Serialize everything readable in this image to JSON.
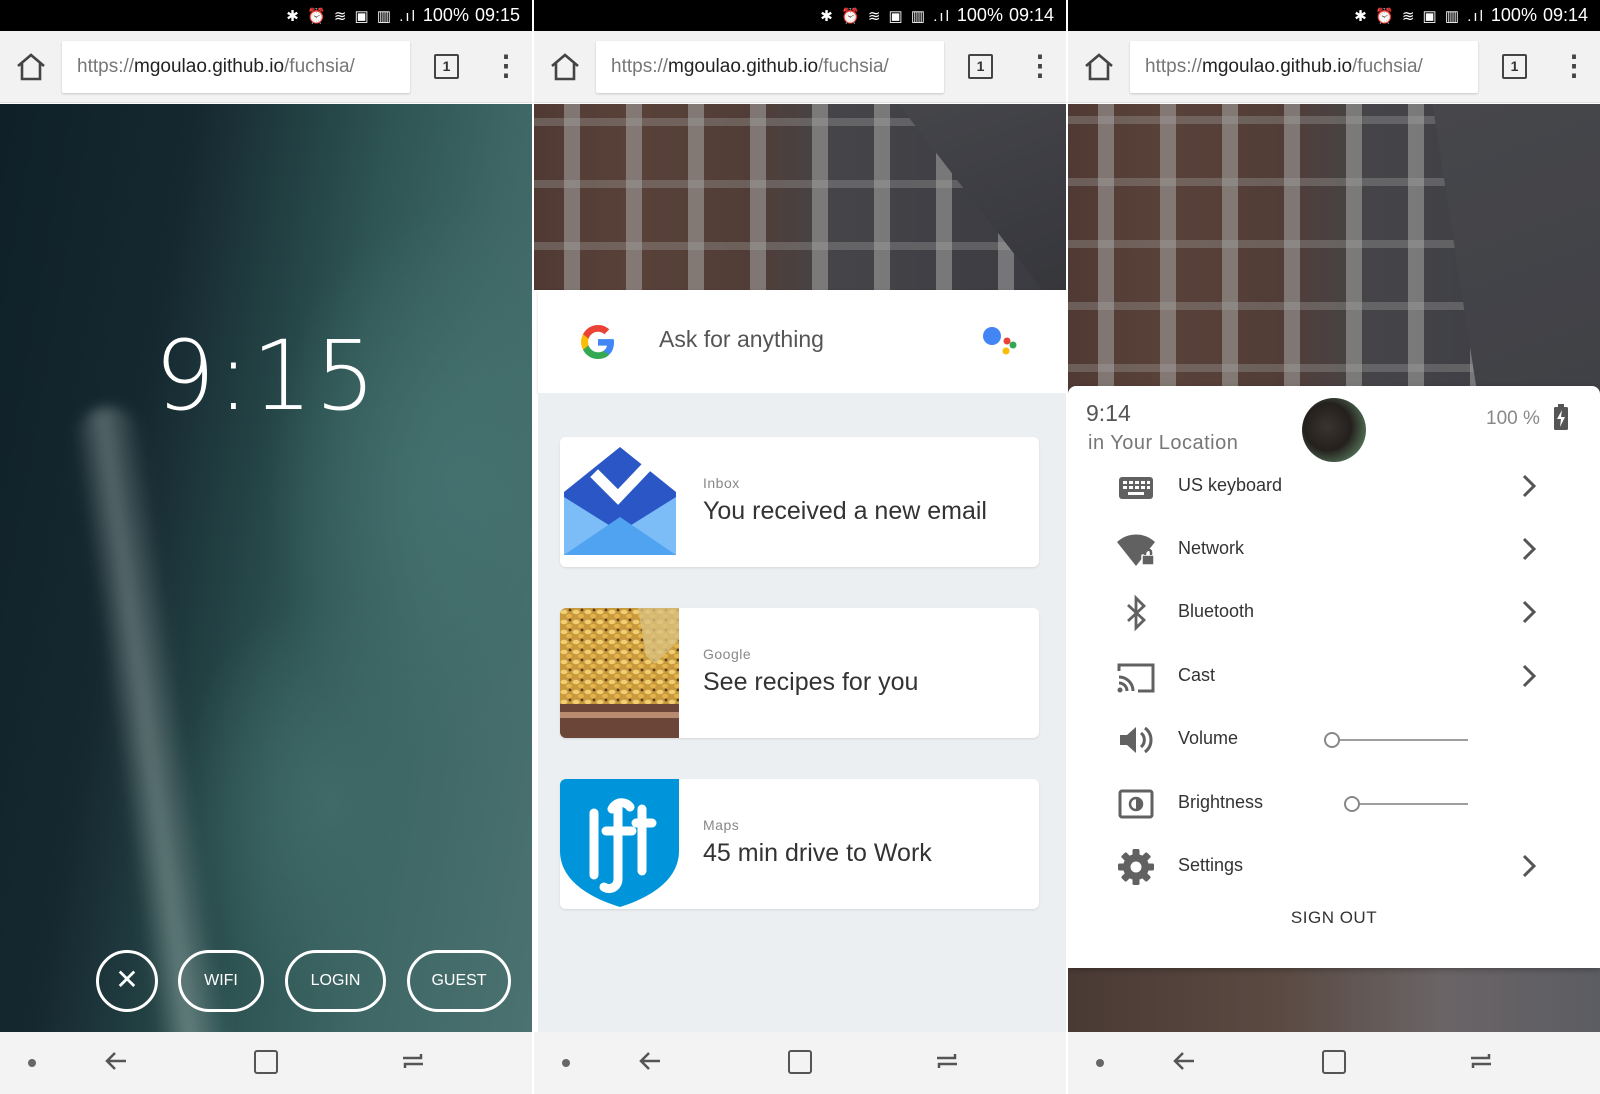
{
  "panels": [
    {
      "status": {
        "icons": "✱ ⏰ ≋ ▣ ▥ .ıl",
        "battery": "100%",
        "clock": "09:15"
      },
      "url": {
        "scheme": "https://",
        "host": "mgoulao.github.io",
        "path": "/fuchsia/"
      },
      "tab_count": "1",
      "lock": {
        "time": "9:15",
        "close_label": "✕",
        "buttons": [
          "WIFI",
          "LOGIN",
          "GUEST"
        ]
      }
    },
    {
      "status": {
        "icons": "✱ ⏰ ≋ ▣ ▥ .ıl",
        "battery": "100%",
        "clock": "09:14"
      },
      "url": {
        "scheme": "https://",
        "host": "mgoulao.github.io",
        "path": "/fuchsia/"
      },
      "tab_count": "1",
      "search": {
        "placeholder": "Ask for anything"
      },
      "cards": [
        {
          "source": "Inbox",
          "message": "You received a new email"
        },
        {
          "source": "Google",
          "message": "See recipes for you"
        },
        {
          "source": "Maps",
          "message": "45 min drive to Work"
        }
      ]
    },
    {
      "status": {
        "icons": "✱ ⏰ ≋ ▣ ▥ .ıl",
        "battery": "100%",
        "clock": "09:14"
      },
      "url": {
        "scheme": "https://",
        "host": "mgoulao.github.io",
        "path": "/fuchsia/"
      },
      "tab_count": "1",
      "quick_settings": {
        "time": "9:14",
        "location": "in Your Location",
        "battery": "100 %",
        "items": [
          {
            "label": "US keyboard",
            "icon": "keyboard-icon"
          },
          {
            "label": "Network",
            "icon": "wifi-lock-icon"
          },
          {
            "label": "Bluetooth",
            "icon": "bluetooth-icon"
          },
          {
            "label": "Cast",
            "icon": "cast-icon"
          },
          {
            "label": "Volume",
            "icon": "volume-icon",
            "level": 0.0
          },
          {
            "label": "Brightness",
            "icon": "brightness-icon",
            "level": 0.0
          },
          {
            "label": "Settings",
            "icon": "gear-icon"
          }
        ],
        "sign_out": "SIGN OUT"
      }
    }
  ],
  "colors": {
    "google_blue": "#4285F4",
    "google_red": "#EA4335",
    "google_yellow": "#FBBC05",
    "google_green": "#34A853",
    "inbox_blue": "#4285F4",
    "maps_shield": "#0095DA"
  }
}
